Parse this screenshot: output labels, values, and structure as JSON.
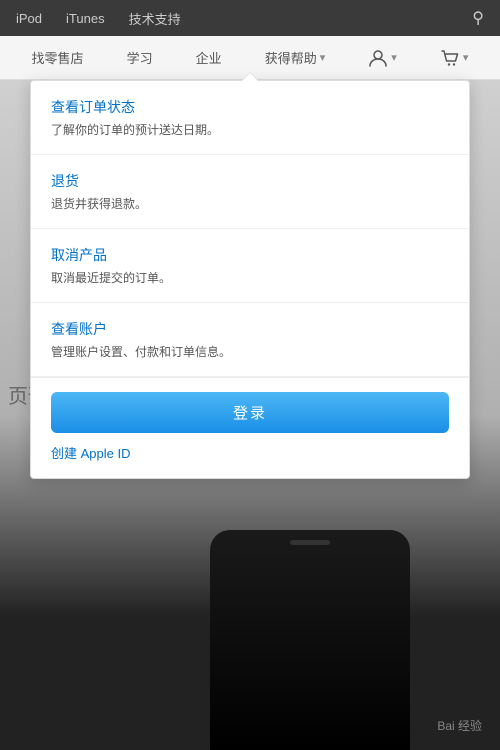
{
  "topNav": {
    "items": [
      {
        "label": "iPod",
        "id": "ipod"
      },
      {
        "label": "iTunes",
        "id": "itunes"
      },
      {
        "label": "技术支持",
        "id": "tech-support"
      }
    ],
    "searchIcon": "⌕"
  },
  "secNav": {
    "items": [
      {
        "label": "找零售店",
        "id": "retail"
      },
      {
        "label": "学习",
        "id": "learn"
      },
      {
        "label": "企业",
        "id": "enterprise"
      },
      {
        "label": "获得帮助",
        "id": "help",
        "hasDropdown": true
      }
    ],
    "userIcon": "👤",
    "cartIcon": "🛒"
  },
  "dropdown": {
    "items": [
      {
        "title": "查看订单状态",
        "desc": "了解你的订单的预计送达日期。"
      },
      {
        "title": "退货",
        "desc": "退货并获得退款。"
      },
      {
        "title": "取消产品",
        "desc": "取消最近提交的订单。"
      },
      {
        "title": "查看账户",
        "desc": "管理账户设置、付款和订单信息。"
      }
    ],
    "loginBtn": "登录",
    "createAppleId": "创建 Apple ID"
  },
  "pageText": "页预",
  "baiduWatermark": "Bai 经验"
}
